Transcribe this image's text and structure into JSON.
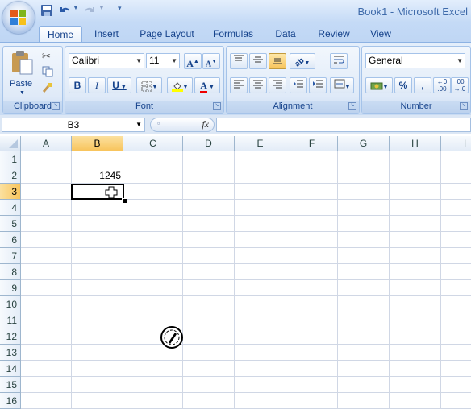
{
  "window": {
    "title": "Book1 - Microsoft Excel"
  },
  "quick_access": {
    "icons": [
      "save-icon",
      "undo-icon",
      "redo-icon",
      "customize-icon"
    ]
  },
  "tabs": [
    {
      "label": "Home",
      "active": true
    },
    {
      "label": "Insert"
    },
    {
      "label": "Page Layout"
    },
    {
      "label": "Formulas"
    },
    {
      "label": "Data"
    },
    {
      "label": "Review"
    },
    {
      "label": "View"
    }
  ],
  "ribbon": {
    "clipboard": {
      "label": "Clipboard",
      "paste_label": "Paste"
    },
    "font": {
      "label": "Font",
      "font_name": "Calibri",
      "font_size": "11",
      "bold": "B",
      "italic": "I",
      "underline": "U",
      "grow": "A",
      "shrink": "A",
      "color": "A"
    },
    "alignment": {
      "label": "Alignment"
    },
    "number": {
      "label": "Number",
      "format": "General",
      "percent": "%",
      "comma": ","
    }
  },
  "formula_bar": {
    "name_box": "B3",
    "fx_label": "fx",
    "formula": ""
  },
  "grid": {
    "columns": [
      "A",
      "B",
      "C",
      "D",
      "E",
      "F",
      "G",
      "H",
      "I"
    ],
    "selected_column": "B",
    "rows": [
      "1",
      "2",
      "3",
      "4",
      "5",
      "6",
      "7",
      "8",
      "9",
      "10",
      "11",
      "12",
      "13",
      "14",
      "15",
      "16"
    ],
    "selected_row": "3",
    "cells": {
      "B2": "1245"
    }
  },
  "colors": {
    "accent": "#15428b",
    "selection": "#f8c45c",
    "gridline": "#d0d7e5"
  }
}
